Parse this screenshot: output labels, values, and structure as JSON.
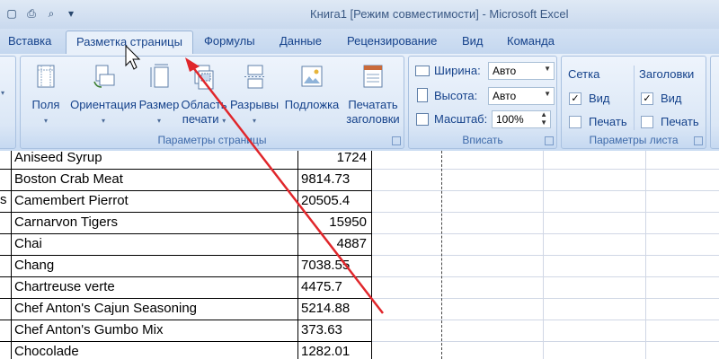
{
  "window": {
    "title": "Книга1  [Режим совместимости]  -  Microsoft Excel",
    "qat_icons": [
      "new-doc-icon",
      "print-icon",
      "print-preview-icon",
      "customize-qat-icon"
    ]
  },
  "tabs": [
    {
      "label": "Вставка"
    },
    {
      "label": "Разметка страницы",
      "active": true
    },
    {
      "label": "Формулы"
    },
    {
      "label": "Данные"
    },
    {
      "label": "Рецензирование"
    },
    {
      "label": "Вид"
    },
    {
      "label": "Команда"
    }
  ],
  "ribbon": {
    "page_setup": {
      "label": "Параметры страницы",
      "buttons": [
        {
          "line1": "Поля",
          "line2": ""
        },
        {
          "line1": "Ориентация",
          "line2": ""
        },
        {
          "line1": "Размер",
          "line2": ""
        },
        {
          "line1": "Область",
          "line2": "печати"
        },
        {
          "line1": "Разрывы",
          "line2": ""
        },
        {
          "line1": "Подложка",
          "line2": ""
        },
        {
          "line1": "Печатать",
          "line2": "заголовки"
        }
      ]
    },
    "fit": {
      "label": "Вписать",
      "width_label": "Ширина:",
      "width_value": "Авто",
      "height_label": "Высота:",
      "height_value": "Авто",
      "scale_label": "Масштаб:",
      "scale_value": "100%"
    },
    "sheet_options": {
      "label": "Параметры листа",
      "gridlines_title": "Сетка",
      "headings_title": "Заголовки",
      "view_label": "Вид",
      "print_label": "Печать",
      "gridlines_view": true,
      "gridlines_print": false,
      "headings_view": true,
      "headings_print": false
    }
  },
  "sheet": {
    "left_clip": "s",
    "rows": [
      {
        "name": "Aniseed Syrup",
        "value": "1724"
      },
      {
        "name": "Boston Crab Meat",
        "value": "9814.73"
      },
      {
        "name": "Camembert Pierrot",
        "value": "20505.4"
      },
      {
        "name": "Carnarvon Tigers",
        "value": "15950"
      },
      {
        "name": "Chai",
        "value": "4887"
      },
      {
        "name": "Chang",
        "value": "7038.55"
      },
      {
        "name": "Chartreuse verte",
        "value": "4475.7"
      },
      {
        "name": "Chef Anton's Cajun Seasoning",
        "value": "5214.88"
      },
      {
        "name": "Chef Anton's Gumbo Mix",
        "value": "373.63"
      },
      {
        "name": "Chocolade",
        "value": "1282.01"
      }
    ]
  },
  "colors": {
    "annotation_arrow": "#e0262b",
    "tab_text": "#15428b"
  }
}
